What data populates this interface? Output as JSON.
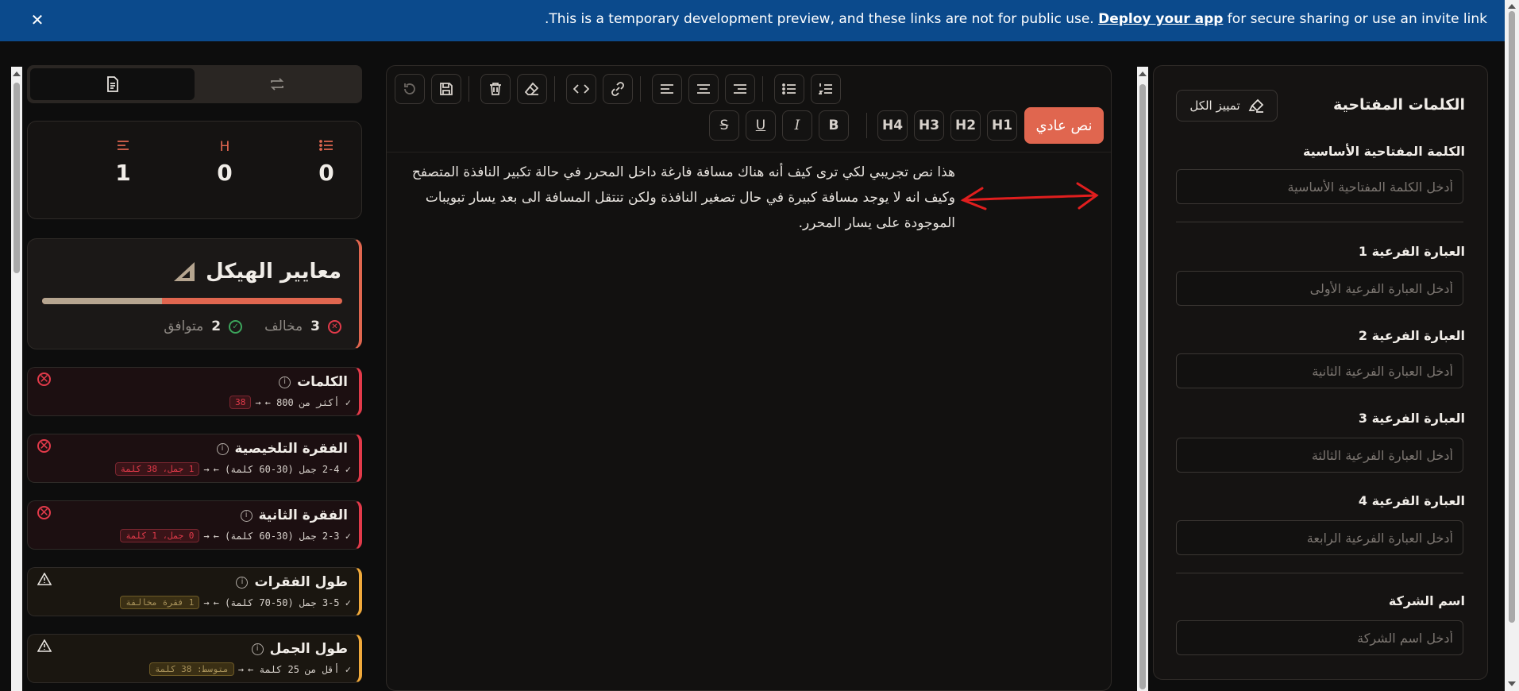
{
  "banner": {
    "message_before": ".This is a temporary development preview, and these links are not for public use. ",
    "link_label": "Deploy your app",
    "message_after": " for secure sharing or use an invite link",
    "close_glyph": "✕"
  },
  "left_panel": {
    "stats": [
      {
        "icon": "list-icon",
        "value": "0"
      },
      {
        "icon": "heading-icon",
        "glyph": "H",
        "value": "0"
      },
      {
        "icon": "paragraph-icon",
        "value": "1"
      }
    ],
    "criteria": {
      "title": "معايير الهيكل",
      "compliant_label": "متوافق",
      "compliant_count": "2",
      "violating_label": "مخالف",
      "violating_count": "3",
      "progress_fraction": 0.4
    },
    "cards": [
      {
        "title": "الكلمات",
        "status": "error",
        "rule": "✓ أكثر من 800 ←",
        "arrow": "→",
        "badge": "38"
      },
      {
        "title": "الفقرة التلخيصية",
        "status": "error",
        "rule": "✓ 2-4 جمل (30-60 كلمة) ←",
        "arrow": "→",
        "badge": "1 جمل، 38 كلمة"
      },
      {
        "title": "الفقرة الثانية",
        "status": "error",
        "rule": "✓ 2-3 جمل (30-60 كلمة) ←",
        "arrow": "→",
        "badge": "0 جمل، 1 كلمة"
      },
      {
        "title": "طول الفقرات",
        "status": "warning",
        "rule": "✓ 3-5 جمل (50-70 كلمة) ←",
        "arrow": "→",
        "badge": "1 فقرة مخالفة"
      },
      {
        "title": "طول الجمل",
        "status": "warning",
        "rule": "✓ أقل من 25 كلمة ←",
        "arrow": "→",
        "badge": "متوسط: 38 كلمة"
      }
    ]
  },
  "editor": {
    "toolbar": {
      "paragraph_label": "نص عادي",
      "h1": "H1",
      "h2": "H2",
      "h3": "H3",
      "h4": "H4",
      "bold": "B",
      "italic": "I",
      "underline": "U",
      "strike": "S"
    },
    "content": "هذا نص تجريبي لكي ترى كيف أنه هناك مسافة فارغة داخل المحرر في حالة تكبير النافذة المتصفح وكيف انه لا يوجد مسافة كبيرة في حال تصغير النافذة ولكن تنتقل المسافة الى بعد يسار تبويبات الموجودة على يسار المحرر."
  },
  "right_panel": {
    "title": "الكلمات المفتاحية",
    "highlight_all": "تمييز الكل",
    "fields": [
      {
        "label": "الكلمة المفتاحية الأساسية",
        "placeholder": "أدخل الكلمة المفتاحية الأساسية",
        "value": ""
      },
      {
        "label": "العبارة الفرعية 1",
        "placeholder": "أدخل العبارة الفرعية الأولى",
        "value": ""
      },
      {
        "label": "العبارة الفرعية 2",
        "placeholder": "أدخل العبارة الفرعية الثانية",
        "value": ""
      },
      {
        "label": "العبارة الفرعية 3",
        "placeholder": "أدخل العبارة الفرعية الثالثة",
        "value": ""
      },
      {
        "label": "العبارة الفرعية 4",
        "placeholder": "أدخل العبارة الفرعية الرابعة",
        "value": ""
      },
      {
        "label": "اسم الشركة",
        "placeholder": "أدخل اسم الشركة",
        "value": ""
      }
    ]
  },
  "colors": {
    "accent": "#e0664f",
    "error": "#e23a4a",
    "warning": "#f0a93b",
    "success": "#3ca55c",
    "banner": "#0b4a8c"
  }
}
